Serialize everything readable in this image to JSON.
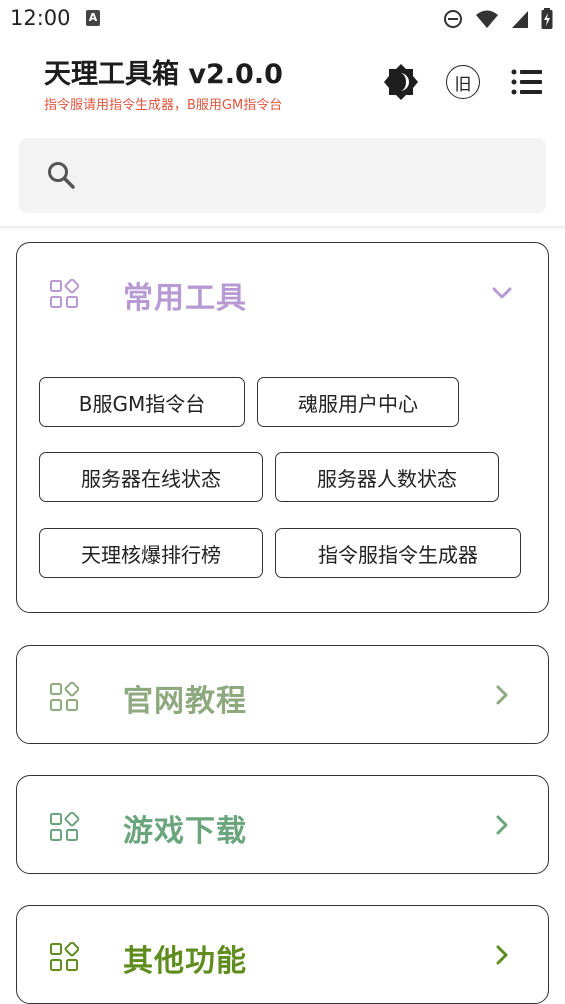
{
  "status_bar": {
    "time": "12:00",
    "notification_icon": "a-letter-icon",
    "icons": [
      "do-not-disturb-icon",
      "wifi-icon",
      "cell-signal-icon",
      "battery-icon"
    ]
  },
  "header": {
    "title": "天理工具箱 v2.0.0",
    "subtitle": "指令服请用指令生成器，B服用GM指令台",
    "subtitle_color": "#e0553f",
    "theme_button": "theme-toggle-icon",
    "old_button_label": "旧",
    "menu_button": "menu-icon"
  },
  "search": {
    "placeholder": "",
    "value": ""
  },
  "sections": {
    "common": {
      "title": "常用工具",
      "color": "#b79ad3",
      "expanded": true,
      "items": [
        "B服GM指令台",
        "魂服用户中心",
        "服务器在线状态",
        "服务器人数状态",
        "天理核爆排行榜",
        "指令服指令生成器"
      ]
    },
    "tutorials": {
      "title": "官网教程",
      "color": "#8fa97f",
      "expanded": false
    },
    "downloads": {
      "title": "游戏下载",
      "color": "#6aa57d",
      "expanded": false
    },
    "others": {
      "title": "其他功能",
      "color": "#5e8d1e",
      "expanded": false
    }
  }
}
